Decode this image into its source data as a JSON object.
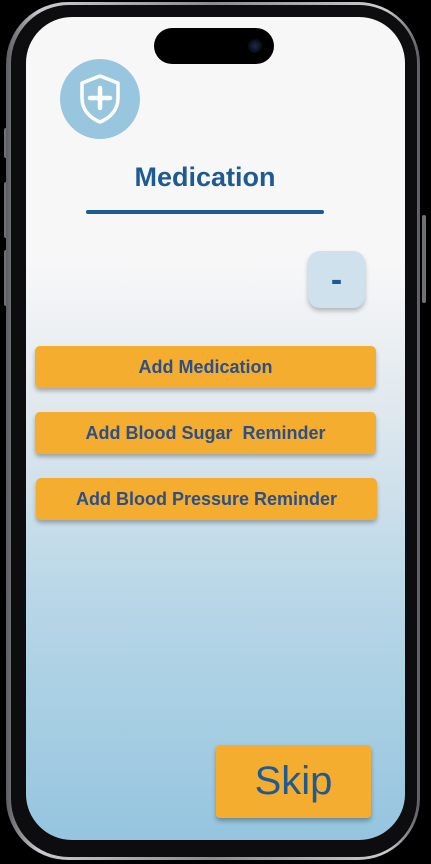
{
  "screen": {
    "title": "Medication",
    "logo_icon": "shield-plus-icon",
    "minus_label": "-",
    "buttons": [
      {
        "label": "Add Medication"
      },
      {
        "label": "Add Blood Sugar  Reminder"
      },
      {
        "label": "Add Blood Pressure Reminder"
      }
    ],
    "skip_label": "Skip"
  },
  "colors": {
    "primary_blue": "#1f5a93",
    "button_orange": "#f5ad2f",
    "logo_circle": "#98c6df"
  }
}
